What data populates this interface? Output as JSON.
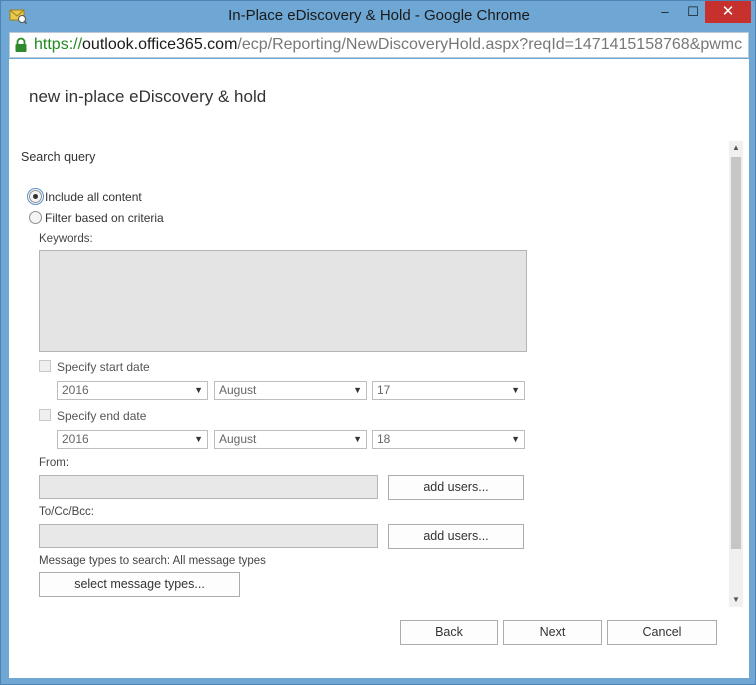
{
  "window": {
    "title": "In-Place eDiscovery & Hold - Google Chrome",
    "min_glyph": "‒",
    "max_glyph": "☐",
    "close_glyph": "✕"
  },
  "url": {
    "scheme": "https://",
    "host": "outlook.office365.com",
    "path": "/ecp/Reporting/NewDiscoveryHold.aspx?reqId=1471415158768&pwmc"
  },
  "dialog": {
    "title": "new in-place eDiscovery & hold",
    "section_title": "Search query",
    "radio_include_all": "Include all content",
    "radio_filter": "Filter based on criteria",
    "selected_option": "Include all content",
    "keywords_label": "Keywords:",
    "keywords_value": "",
    "start_date": {
      "label": "Specify start date",
      "checked": false,
      "year": "2016",
      "month": "August",
      "day": "17"
    },
    "end_date": {
      "label": "Specify end date",
      "checked": false,
      "year": "2016",
      "month": "August",
      "day": "18"
    },
    "from_label": "From:",
    "from_value": "",
    "add_users_label": "add users...",
    "to_label": "To/Cc/Bcc:",
    "to_value": "",
    "message_types_label": "Message types to search:",
    "message_types_value": "All message types",
    "select_message_types_label": "select message types..."
  },
  "footer": {
    "back_label": "Back",
    "next_label": "Next",
    "cancel_label": "Cancel"
  },
  "colors": {
    "frame": "#6fa7d4",
    "close_button": "#c7312d",
    "url_scheme": "#1f8a1f"
  },
  "icons": {
    "app": "ediscovery-app-icon",
    "lock": "lock-icon",
    "dropdown": "chevron-down-icon"
  }
}
